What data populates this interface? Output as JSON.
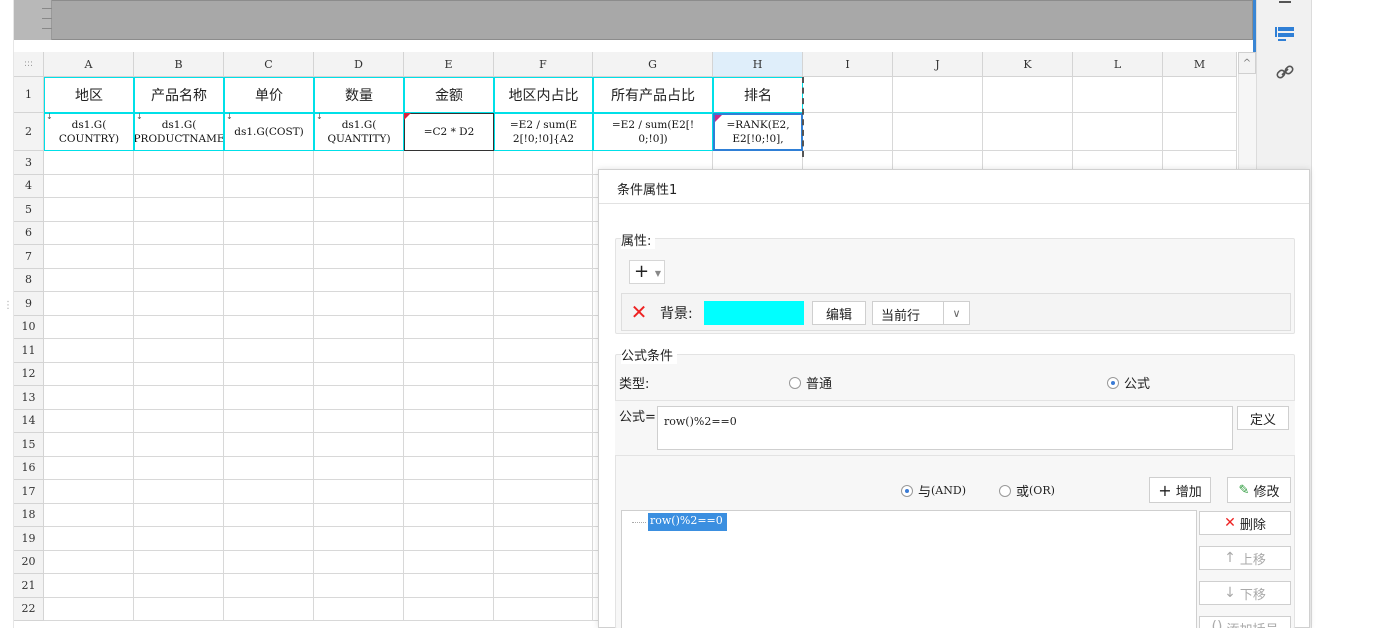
{
  "columns": [
    "A",
    "B",
    "C",
    "D",
    "E",
    "F",
    "G",
    "H",
    "I",
    "J",
    "K",
    "L",
    "M"
  ],
  "rows": [
    "1",
    "2",
    "3",
    "4",
    "5",
    "6",
    "7",
    "8",
    "9",
    "10",
    "11",
    "12",
    "13",
    "14",
    "15",
    "16",
    "17",
    "18",
    "19",
    "20",
    "21",
    "22"
  ],
  "header_row": [
    "地区",
    "产品名称",
    "单价",
    "数量",
    "金额",
    "地区内占比",
    "所有产品占比",
    "排名"
  ],
  "formula_row": [
    "ds1.G(\nCOUNTRY)",
    "ds1.G(\nPRODUCTNAME",
    "ds1.G(COST)",
    "ds1.G(\nQUANTITY)",
    "=C2 * D2",
    "=E2 / sum(E\n2[!0;!0]{A2",
    "=E2 / sum(E2[!\n0;!0])",
    "=RANK(E2,\nE2[!0;!0],"
  ],
  "corner_label": ":::",
  "dialog": {
    "title": "条件属性1",
    "attr_section": "属性",
    "plus": "+",
    "attr_name": "背景:",
    "color": "#00ffff",
    "edit_btn": "编辑",
    "scope_value": "当前行",
    "formula_section": "公式条件",
    "type_label": "类型:",
    "radio_normal": "普通",
    "radio_formula": "公式",
    "formula_label": "公式=",
    "formula_value": "row()%2==0",
    "define_btn": "定义",
    "and_label": "与",
    "and_suffix": "(AND)",
    "or_label": "或",
    "or_suffix": "(OR)",
    "add_btn": "增加",
    "modify_btn": "修改",
    "list_item": "row()%2==0",
    "delete_btn": "删除",
    "up_btn": "上移",
    "down_btn": "下移",
    "bracket_btn": "添加括号"
  },
  "icons": {
    "toolbar_1": "cell-attribute-icon",
    "toolbar_2": "link-icon"
  },
  "colors": {
    "accent": "#2f7fd6",
    "highlight": "#00ffff",
    "delete": "#e22222"
  }
}
